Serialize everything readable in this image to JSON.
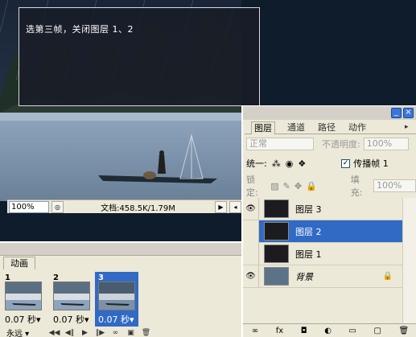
{
  "overlay": {
    "text": "选第三帧，关闭图层 1、2"
  },
  "document": {
    "zoom": "100%",
    "info": "文档:458.5K/1.79M"
  },
  "animation": {
    "tab": "动画",
    "frames": [
      {
        "number": "1",
        "delay": "0.07 秒▾",
        "selected": false
      },
      {
        "number": "2",
        "delay": "0.07 秒▾",
        "selected": false
      },
      {
        "number": "3",
        "delay": "0.07 秒▾",
        "selected": true
      }
    ],
    "loop": "永远 ▾",
    "controls": [
      "◀◀",
      "◀‖",
      "▶",
      "‖▶",
      "∞",
      "▣",
      "🗑"
    ]
  },
  "layers_panel": {
    "tabs": [
      "图层",
      "通道",
      "路径",
      "动作"
    ],
    "blend_mode": "正常",
    "opacity_label": "不透明度:",
    "opacity_value": "100%",
    "unify_label": "统一:",
    "propagate_label": "传播帧 1",
    "lock_label": "锁定:",
    "fill_label": "填充:",
    "fill_value": "100%",
    "layers": [
      {
        "name": "图层 3",
        "visible": true,
        "selected": false
      },
      {
        "name": "图层 2",
        "visible": false,
        "selected": true
      },
      {
        "name": "图层 1",
        "visible": false,
        "selected": false
      },
      {
        "name": "背景",
        "visible": true,
        "selected": false,
        "locked": true
      }
    ],
    "bottom_buttons": [
      "∞",
      "fx",
      "◘",
      "◐",
      "▭",
      "▢",
      "🗑"
    ]
  },
  "colors": {
    "selection": "#316ac5",
    "panel": "#ece9d8"
  }
}
